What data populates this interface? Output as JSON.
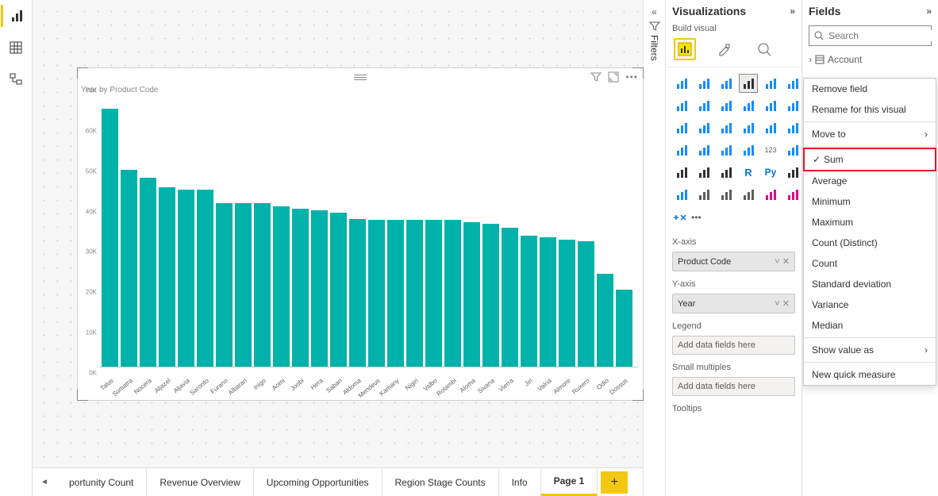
{
  "view_switcher": [
    "report-view",
    "data-view",
    "model-view"
  ],
  "visual": {
    "title": "Year by Product Code",
    "actions": [
      "filter-icon",
      "focus-icon",
      "more-icon"
    ]
  },
  "chart_data": {
    "type": "bar",
    "title": "Year by Product Code",
    "xlabel": "Product Code",
    "ylabel": "Year",
    "ylim": [
      0,
      70000
    ],
    "yticks": [
      "0K",
      "10K",
      "20K",
      "30K",
      "40K",
      "50K",
      "60K",
      "70K"
    ],
    "categories": [
      "Talus",
      "Sumatra",
      "Nocera",
      "Aljazel",
      "Aljavia",
      "Saronto",
      "Furano",
      "Albaran",
      "Inigo",
      "Aomi",
      "Joobi",
      "Hera",
      "Saban",
      "Aldoma",
      "Mendeus",
      "Kamany",
      "Nigiri",
      "Valbo",
      "Rolambi",
      "Aloma",
      "Sivana",
      "Vierra",
      "Jiri",
      "Valria",
      "Almore",
      "Ruxero",
      "Odio",
      "Dossus"
    ],
    "values": [
      67000,
      51000,
      49000,
      46500,
      46000,
      46000,
      42500,
      42500,
      42500,
      41500,
      41000,
      40500,
      40000,
      38200,
      38000,
      38000,
      38000,
      38000,
      38000,
      37500,
      37000,
      36000,
      34000,
      33500,
      33000,
      32500,
      24000,
      20000
    ]
  },
  "tabs": {
    "items": [
      "portunity Count",
      "Revenue Overview",
      "Upcoming Opportunities",
      "Region Stage Counts",
      "Info",
      "Page 1"
    ],
    "active_index": 5
  },
  "filters_label": "Filters",
  "viz_pane": {
    "title": "Visualizations",
    "subtitle": "Build visual",
    "wells": {
      "xaxis_label": "X-axis",
      "xaxis_value": "Product Code",
      "yaxis_label": "Y-axis",
      "yaxis_value": "Year",
      "legend_label": "Legend",
      "legend_placeholder": "Add data fields here",
      "small_label": "Small multiples",
      "small_placeholder": "Add data fields here",
      "tooltips_label": "Tooltips"
    }
  },
  "fields_pane": {
    "title": "Fields",
    "search_placeholder": "Search",
    "first_table": "Account"
  },
  "context_menu": {
    "remove": "Remove field",
    "rename": "Rename for this visual",
    "moveto": "Move to",
    "sum": "Sum",
    "average": "Average",
    "minimum": "Minimum",
    "maximum": "Maximum",
    "countdistinct": "Count (Distinct)",
    "count": "Count",
    "stddev": "Standard deviation",
    "variance": "Variance",
    "median": "Median",
    "showvalueas": "Show value as",
    "newquick": "New quick measure"
  }
}
